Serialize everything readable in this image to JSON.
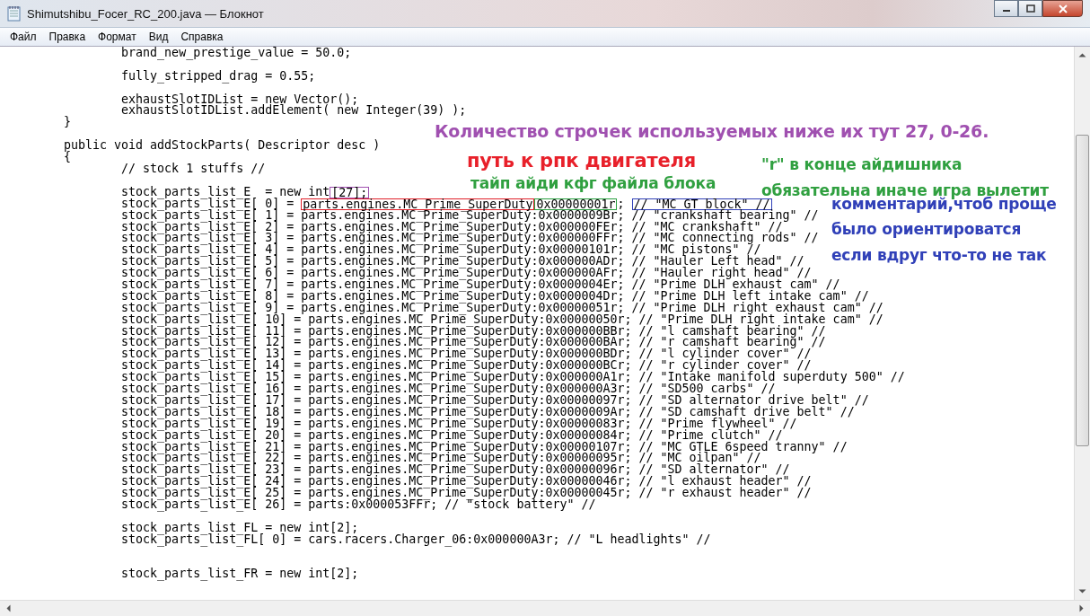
{
  "window": {
    "title": "Shimutshibu_Focer_RC_200.java — Блокнот"
  },
  "menu": [
    "Файл",
    "Правка",
    "Формат",
    "Вид",
    "Справка"
  ],
  "lines": [
    {
      "kind": "code",
      "text": "                brand_new_prestige_value = 50.0;"
    },
    {
      "kind": "blank"
    },
    {
      "kind": "code",
      "text": "                fully_stripped_drag = 0.55;"
    },
    {
      "kind": "blank"
    },
    {
      "kind": "code",
      "text": "                exhaustSlotIDList = new Vector();"
    },
    {
      "kind": "code",
      "text": "                exhaustSlotIDList.addElement( new Integer(39) );"
    },
    {
      "kind": "code",
      "text": "        }"
    },
    {
      "kind": "blank"
    },
    {
      "kind": "code",
      "text": "        public void addStockParts( Descriptor desc )"
    },
    {
      "kind": "code",
      "text": "        {"
    },
    {
      "kind": "code",
      "text": "                // stock 1 stuffs //"
    },
    {
      "kind": "blank"
    },
    {
      "kind": "marked",
      "parts": [
        {
          "text": "                stock_parts_list_E  = new int"
        },
        {
          "text": "[27];",
          "color": "#a050b0"
        }
      ]
    },
    {
      "kind": "marked",
      "parts": [
        {
          "text": "                stock_parts_list_E[ 0] = "
        },
        {
          "text": "parts.engines.MC_Prime_SuperDuty",
          "color": "#e0202a"
        },
        {
          "text": "0x00000001r",
          "color": "#2aa040"
        },
        {
          "text": "; "
        },
        {
          "text": "// \"MC GT block\" //",
          "color": "#3040b8"
        }
      ]
    },
    {
      "kind": "code",
      "text": "                stock_parts_list_E[ 1] = parts.engines.MC_Prime_SuperDuty:0x0000009Br; // \"crankshaft bearing\" //"
    },
    {
      "kind": "code",
      "text": "                stock_parts_list_E[ 2] = parts.engines.MC_Prime_SuperDuty:0x000000FEr; // \"MC crankshaft\" //"
    },
    {
      "kind": "code",
      "text": "                stock_parts_list_E[ 3] = parts.engines.MC_Prime_SuperDuty:0x000000FFr; // \"MC connecting rods\" //"
    },
    {
      "kind": "code",
      "text": "                stock_parts_list_E[ 4] = parts.engines.MC_Prime_SuperDuty:0x00000101r; // \"MC pistons\" //"
    },
    {
      "kind": "code",
      "text": "                stock_parts_list_E[ 5] = parts.engines.MC_Prime_SuperDuty:0x000000ADr; // \"Hauler Left head\" //"
    },
    {
      "kind": "code",
      "text": "                stock_parts_list_E[ 6] = parts.engines.MC_Prime_SuperDuty:0x000000AFr; // \"Hauler right head\" //"
    },
    {
      "kind": "code",
      "text": "                stock_parts_list_E[ 7] = parts.engines.MC_Prime_SuperDuty:0x0000004Er; // \"Prime DLH exhaust cam\" //"
    },
    {
      "kind": "code",
      "text": "                stock_parts_list_E[ 8] = parts.engines.MC_Prime_SuperDuty:0x0000004Dr; // \"Prime DLH left intake cam\" //"
    },
    {
      "kind": "code",
      "text": "                stock_parts_list_E[ 9] = parts.engines.MC_Prime_SuperDuty:0x00000051r; // \"Prime DLH right exhaust cam\" //"
    },
    {
      "kind": "code",
      "text": "                stock_parts_list_E[ 10] = parts.engines.MC_Prime_SuperDuty:0x00000050r; // \"Prime DLH right intake cam\" //"
    },
    {
      "kind": "code",
      "text": "                stock_parts_list_E[ 11] = parts.engines.MC_Prime_SuperDuty:0x000000BBr; // \"l camshaft bearing\" //"
    },
    {
      "kind": "code",
      "text": "                stock_parts_list_E[ 12] = parts.engines.MC_Prime_SuperDuty:0x000000BAr; // \"r camshaft bearing\" //"
    },
    {
      "kind": "code",
      "text": "                stock_parts_list_E[ 13] = parts.engines.MC_Prime_SuperDuty:0x000000BDr; // \"l cylinder cover\" //"
    },
    {
      "kind": "code",
      "text": "                stock_parts_list_E[ 14] = parts.engines.MC_Prime_SuperDuty:0x000000BCr; // \"r cylinder cover\" //"
    },
    {
      "kind": "code",
      "text": "                stock_parts_list_E[ 15] = parts.engines.MC_Prime_SuperDuty:0x000000A1r; // \"Intake manifold superduty 500\" //"
    },
    {
      "kind": "code",
      "text": "                stock_parts_list_E[ 16] = parts.engines.MC_Prime_SuperDuty:0x000000A3r; // \"SD500 carbs\" //"
    },
    {
      "kind": "code",
      "text": "                stock_parts_list_E[ 17] = parts.engines.MC_Prime_SuperDuty:0x00000097r; // \"SD alternator drive belt\" //"
    },
    {
      "kind": "code",
      "text": "                stock_parts_list_E[ 18] = parts.engines.MC_Prime_SuperDuty:0x0000009Ar; // \"SD camshaft drive belt\" //"
    },
    {
      "kind": "code",
      "text": "                stock_parts_list_E[ 19] = parts.engines.MC_Prime_SuperDuty:0x00000083r; // \"Prime flywheel\" //"
    },
    {
      "kind": "code",
      "text": "                stock_parts_list_E[ 20] = parts.engines.MC_Prime_SuperDuty:0x00000084r; // \"Prime clutch\" //"
    },
    {
      "kind": "code",
      "text": "                stock_parts_list_E[ 21] = parts.engines.MC_Prime_SuperDuty:0x00000107r; // \"MC GTLE 6speed tranny\" //"
    },
    {
      "kind": "code",
      "text": "                stock_parts_list_E[ 22] = parts.engines.MC_Prime_SuperDuty:0x00000095r; // \"MC oilpan\" //"
    },
    {
      "kind": "code",
      "text": "                stock_parts_list_E[ 23] = parts.engines.MC_Prime_SuperDuty:0x00000096r; // \"SD alternator\" //"
    },
    {
      "kind": "code",
      "text": "                stock_parts_list_E[ 24] = parts.engines.MC_Prime_SuperDuty:0x00000046r; // \"l exhaust header\" //"
    },
    {
      "kind": "code",
      "text": "                stock_parts_list_E[ 25] = parts.engines.MC_Prime_SuperDuty:0x00000045r; // \"r exhaust header\" //"
    },
    {
      "kind": "code",
      "text": "                stock_parts_list_E[ 26] = parts:0x000053FFr; // \"stock battery\" //"
    },
    {
      "kind": "blank"
    },
    {
      "kind": "code",
      "text": "                stock_parts_list_FL = new int[2];"
    },
    {
      "kind": "code",
      "text": "                stock_parts_list_FL[ 0] = cars.racers.Charger_06:0x000000A3r; // \"L headlights\" //"
    },
    {
      "kind": "blank"
    },
    {
      "kind": "blank"
    },
    {
      "kind": "code",
      "text": "                stock_parts_list_FR = new int[2];"
    }
  ],
  "annotations": [
    {
      "text": "Количество строчек используемых ниже их тут 27, 0-26.",
      "color": "#a050b0"
    },
    {
      "text": "путь к рпк двигателя",
      "color": "#e8202a"
    },
    {
      "text": "тайп айди кфг файла блока",
      "color": "#30a040"
    },
    {
      "text": "\"r\" в конце айдишника",
      "color": "#30a040"
    },
    {
      "text": "обязательна иначе игра вылетит",
      "color": "#30a040"
    },
    {
      "text": "комментарий,чтоб проще",
      "color": "#3040b8"
    },
    {
      "text": "было ориентироватся",
      "color": "#3040b8"
    },
    {
      "text": "если вдруг что-то не так",
      "color": "#3040b8"
    }
  ]
}
